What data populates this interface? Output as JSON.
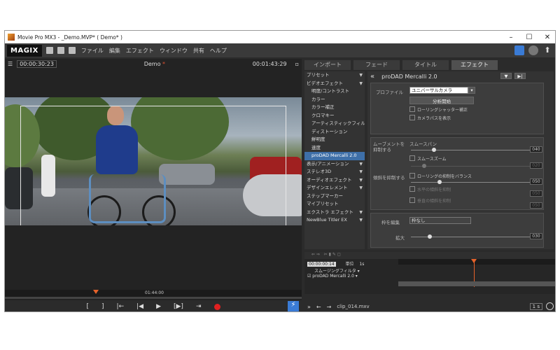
{
  "window": {
    "title": "Movie Pro MX3 - _Demo.MVP* ( Demo* )",
    "min": "–",
    "max": "☐",
    "close": "✕"
  },
  "menubar": {
    "logo": "MAGIX",
    "items": [
      "ファイル",
      "編集",
      "エフェクト",
      "ウィンドウ",
      "共有",
      "ヘルプ"
    ]
  },
  "preview": {
    "timecode": "00:00:30:23",
    "project": "Demo",
    "modified_mark": "*",
    "duration": "00:01:43:29",
    "scrub_time": "01:44:00"
  },
  "transport": {
    "buttons": [
      "[",
      "]",
      "|←",
      "|◀",
      "▶",
      "[▶]",
      "⇥"
    ]
  },
  "tabs": [
    "インポート",
    "フェード",
    "タイトル",
    "エフェクト"
  ],
  "active_tab": "エフェクト",
  "categories": [
    {
      "label": "プリセット",
      "arrow": "▼",
      "sub": false
    },
    {
      "label": "ビデオエフェクト",
      "arrow": "▼",
      "sub": false
    },
    {
      "label": "明度/コントラスト",
      "arrow": "",
      "sub": true
    },
    {
      "label": "カラー",
      "arrow": "",
      "sub": true
    },
    {
      "label": "カラー補正",
      "arrow": "",
      "sub": true
    },
    {
      "label": "クロマキー",
      "arrow": "",
      "sub": true
    },
    {
      "label": "アーティスティックフィル",
      "arrow": "",
      "sub": true
    },
    {
      "label": "ディストーション",
      "arrow": "",
      "sub": true
    },
    {
      "label": "鮮明度",
      "arrow": "",
      "sub": true
    },
    {
      "label": "速度",
      "arrow": "",
      "sub": true
    },
    {
      "label": "proDAD Mercalli 2.0",
      "arrow": "",
      "sub": true,
      "selected": true
    },
    {
      "label": "表示/アニメーション",
      "arrow": "▼",
      "sub": false
    },
    {
      "label": "ステレオ3D",
      "arrow": "▼",
      "sub": false
    },
    {
      "label": "オーディオエフェクト",
      "arrow": "▼",
      "sub": false
    },
    {
      "label": "デザインエレメント",
      "arrow": "▼",
      "sub": false
    },
    {
      "label": "ステップマーカー",
      "arrow": "",
      "sub": false
    },
    {
      "label": "マイプリセット",
      "arrow": "",
      "sub": false
    },
    {
      "label": "エクストラ エフェクト",
      "arrow": "▼",
      "sub": false
    },
    {
      "label": "NewBlue Titler EX",
      "arrow": "▼",
      "sub": false
    }
  ],
  "fx": {
    "title": "proDAD Mercalli 2.0",
    "back": "«",
    "profile_label": "プロファイル",
    "profile_value": "ユニバーサルカメラ",
    "analyze_button": "分析開始",
    "rolling_shutter": "ローリングシャッター補正",
    "show_camera_path": "カメラパスを表示",
    "smooth_label": "ムーブメントを抑制する",
    "smooth_pan": "スムースパン",
    "smooth_zoom": "スムースズーム",
    "value_40": "040",
    "value_20": "020",
    "tilt_label": "傾斜を抑制する",
    "rolling_balance": "ローリングの抑制をバランス",
    "value_50a": "050",
    "value_50b": "050",
    "value_50c": "050",
    "horizontal": "水平の傾斜を抑制",
    "vertical": "垂直の傾斜を抑制",
    "border_label": "枠を編集",
    "border_value": "枠なし",
    "zoom_label": "拡大",
    "value_30": "030",
    "settings_btn": "▼",
    "nav_btn": "▶|"
  },
  "fxtrack": {
    "timecode": "00:00:00:14",
    "unit_label": "単位",
    "unit_value": "1s",
    "row1": "スムージングフィルタ",
    "row2": "proDAD Mercalli 2.0"
  },
  "bottom": {
    "filename": "clip_014.mxv",
    "speed": "1 s",
    "controls": [
      "»",
      "←",
      "→"
    ]
  }
}
